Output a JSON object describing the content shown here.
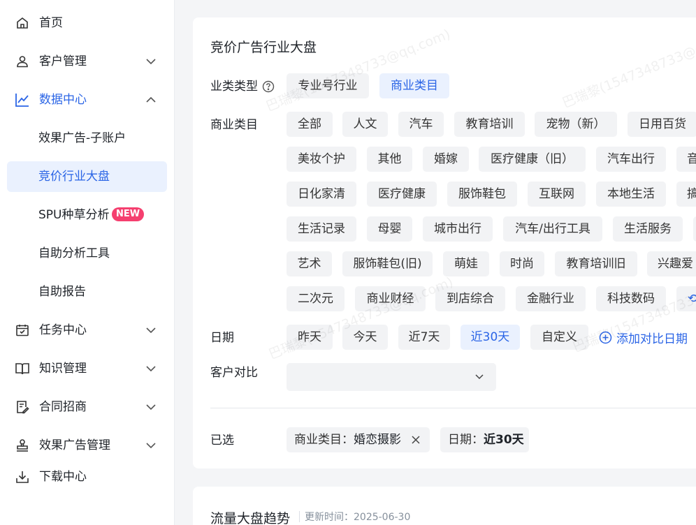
{
  "sidebar": {
    "items": [
      {
        "label": "首页",
        "icon": "home-icon"
      },
      {
        "label": "客户管理",
        "icon": "user-icon"
      },
      {
        "label": "数据中心",
        "icon": "chart-line-icon"
      },
      {
        "label": "任务中心",
        "icon": "calendar-check-icon"
      },
      {
        "label": "知识管理",
        "icon": "book-icon"
      },
      {
        "label": "合同招商",
        "icon": "contract-icon"
      },
      {
        "label": "效果广告管理",
        "icon": "stamp-icon"
      },
      {
        "label": "下载中心",
        "icon": "download-icon"
      }
    ],
    "sub_items": [
      {
        "label": "效果广告-子账户"
      },
      {
        "label": "竞价行业大盘"
      },
      {
        "label": "SPU种草分析",
        "badge": "NEW"
      },
      {
        "label": "自助分析工具"
      },
      {
        "label": "自助报告"
      }
    ],
    "active_color": "#2b65e6"
  },
  "panel": {
    "title": "竞价广告行业大盘",
    "industry_type": {
      "label": "业类类型",
      "options": [
        "专业号行业",
        "商业类目"
      ],
      "selected": "商业类目"
    },
    "category": {
      "label": "商业类目",
      "rows": [
        [
          "全部",
          "人文",
          "汽车",
          "教育培训",
          "宠物（新）",
          "日用百货"
        ],
        [
          "美妆个护",
          "其他",
          "婚嫁",
          "医疗健康（旧）",
          "汽车出行",
          "音"
        ],
        [
          "日化家清",
          "医疗健康",
          "服饰鞋包",
          "互联网",
          "本地生活",
          "搞"
        ],
        [
          "生活记录",
          "母婴",
          "城市出行",
          "汽车/出行工具",
          "生活服务",
          ""
        ],
        [
          "艺术",
          "服饰鞋包(旧)",
          "萌娃",
          "时尚",
          "教育培训旧",
          "兴趣爱"
        ],
        [
          "二次元",
          "商业财经",
          "到店综合",
          "金融行业",
          "科技数码",
          "⟲"
        ]
      ]
    },
    "date": {
      "label": "日期",
      "options": [
        "昨天",
        "今天",
        "近7天",
        "近30天",
        "自定义"
      ],
      "selected": "近30天",
      "add_compare": "添加对比日期"
    },
    "customer_compare": {
      "label": "客户对比",
      "value": ""
    },
    "selected": {
      "label": "已选",
      "tags": [
        {
          "key": "商业类目：",
          "value": "婚恋摄影",
          "closable": true
        },
        {
          "key": "日期：",
          "value": "近30天",
          "closable": false
        }
      ]
    }
  },
  "trend": {
    "title": "流量大盘趋势",
    "updated_label": "更新时间：",
    "updated_value": "2025-06-30"
  },
  "watermark": "巴瑞黎(1547348733@qq.com)"
}
